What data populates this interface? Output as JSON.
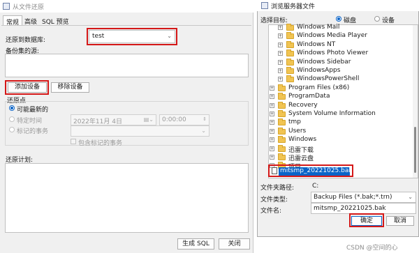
{
  "left": {
    "title": "从文件还原",
    "tabs": [
      "常规",
      "高级",
      "SQL 预览"
    ],
    "restore_db_label": "还原到数据库:",
    "restore_db_value": "test",
    "backup_source_label": "备份集的源:",
    "add_device": "添加设备",
    "remove_device": "移除设备",
    "restore_point_label": "还原点",
    "latest": "可能最新的",
    "specific_time": "特定时间",
    "marked_txn": "标记的事务",
    "date_value": "2022年11月  4日",
    "time_value": "0:00:00",
    "include_mark": "包含标记的事务",
    "restore_plan_label": "还原计划:",
    "gen_sql": "生成 SQL",
    "close": "关闭"
  },
  "right": {
    "title": "浏览服务器文件",
    "select_target_label": "选择目标:",
    "disk": "磁盘",
    "device": "设备",
    "tree": [
      {
        "label": "Windows Mail",
        "depth": 1
      },
      {
        "label": "Windows Media Player",
        "depth": 1
      },
      {
        "label": "Windows NT",
        "depth": 1
      },
      {
        "label": "Windows Photo Viewer",
        "depth": 1
      },
      {
        "label": "Windows Sidebar",
        "depth": 1
      },
      {
        "label": "WindowsApps",
        "depth": 1
      },
      {
        "label": "WindowsPowerShell",
        "depth": 1
      },
      {
        "label": "Program Files (x86)",
        "depth": 0
      },
      {
        "label": "ProgramData",
        "depth": 0
      },
      {
        "label": "Recovery",
        "depth": 0
      },
      {
        "label": "System Volume Information",
        "depth": 0
      },
      {
        "label": "tmp",
        "depth": 0
      },
      {
        "label": "Users",
        "depth": 0
      },
      {
        "label": "Windows",
        "depth": 0
      },
      {
        "label": "迅雷下载",
        "depth": 0
      },
      {
        "label": "迅雷云盘",
        "depth": 0
      },
      {
        "label": "项目",
        "depth": 0
      }
    ],
    "selected_file": "mitsmp_20221025.bak",
    "folder_path_label": "文件夹路径:",
    "folder_path_value": "C:",
    "file_type_label": "文件类型:",
    "file_type_value": "Backup Files (*.bak;*.trn)",
    "file_name_label": "文件名:",
    "file_name_value": "mitsmp_20221025.bak",
    "ok": "确定",
    "cancel": "取消"
  },
  "watermark": "CSDN @空间的心",
  "colors": {
    "highlight_red": "#d41818",
    "selection_blue": "#0a64c8",
    "folder_yellow": "#f1c452"
  }
}
